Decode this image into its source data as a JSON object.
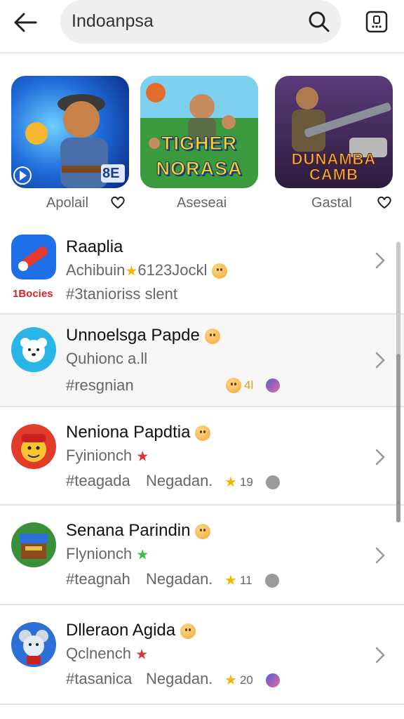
{
  "header": {
    "search_value": "Indoanpsa"
  },
  "carousel": [
    {
      "title": "",
      "label": "Apolail",
      "favorite": false,
      "art": "hero-character",
      "colors": [
        "#1c4fc8",
        "#f39a2b"
      ]
    },
    {
      "title": "TIGHER NORASA",
      "label": "Aseseai",
      "favorite": false,
      "art": "soldiers",
      "colors": [
        "#2f8f3a",
        "#f5d21e"
      ]
    },
    {
      "title": "DUNAMBA CAMB",
      "label": "Gastal",
      "favorite": false,
      "art": "gunner",
      "colors": [
        "#4a2f5c",
        "#e87a2b"
      ]
    }
  ],
  "card0_badge": "8E",
  "list": [
    {
      "name": "Raaplia",
      "sub": "Achibuin",
      "sub_extra": "6123Jockl",
      "tag": "#3tanioriss slent",
      "badge": "1Bocies",
      "meta": "",
      "icon_color": "#1f6fe8"
    },
    {
      "name": "Unnoelsga Papde",
      "sub": "Quhionc a.ll",
      "sub_extra": "",
      "tag": "#resgnian",
      "badge": "",
      "meta": "4l",
      "icon_color": "#29b6e6"
    },
    {
      "name": "Neniona Papdtia",
      "sub": "Fyinionch",
      "sub_extra": "",
      "tag": "#teagada",
      "tag2": "Negadan.",
      "badge": "",
      "meta": "19",
      "icon_color": "#e23b2a"
    },
    {
      "name": "Senana Parindin",
      "sub": "Flynionch",
      "sub_extra": "",
      "tag": "#teagnah",
      "tag2": "Negadan.",
      "badge": "",
      "meta": "11",
      "icon_color": "#3a8f3a"
    },
    {
      "name": "Dlleraon Agida",
      "sub": "Qclnench",
      "sub_extra": "",
      "tag": "#tasanica",
      "tag2": "Negadan.",
      "badge": "",
      "meta": "20",
      "icon_color": "#2d6fd6"
    }
  ]
}
